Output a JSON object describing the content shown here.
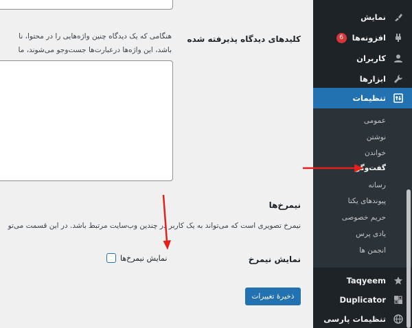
{
  "content": {
    "accepted_keys_label": "کلیدهای دیدگاه پذیرفته شده",
    "accepted_keys_desc_line1": "هنگامی که یک دیدگاه چنین واژه‌هایی را در محتوا، نا",
    "accepted_keys_desc_line2": "باشد، این واژه‌ها درعبارت‌ها جست‌وجو می‌شوند، ما",
    "avatars_title": "نیمرخ‌ها",
    "avatars_desc": "نیمرخ تصویری است که می‌تواند به یک کاربر در چندین وب‌سایت مرتبط باشد. در این قسمت می‌تو",
    "show_avatars_label": "نمایش نیمرخ",
    "show_avatars_checkbox_label": "نمایش نیمرخ‌ها",
    "show_avatars_checked": false,
    "save_button": "ذخیرهٔ تغییرات"
  },
  "sidebar": {
    "items": [
      {
        "label": "نمایش",
        "icon": "brush-icon"
      },
      {
        "label": "افزونه‌ها",
        "icon": "plugin-icon",
        "badge": "6"
      },
      {
        "label": "کاربران",
        "icon": "users-icon"
      },
      {
        "label": "ابزارها",
        "icon": "wrench-icon"
      },
      {
        "label": "تنظیمات",
        "icon": "settings-icon"
      }
    ],
    "submenu": [
      {
        "label": "عمومی"
      },
      {
        "label": "نوشتن"
      },
      {
        "label": "خواندن"
      },
      {
        "label": "گفت‌وگو"
      },
      {
        "label": "رسانه"
      },
      {
        "label": "پیوندهای یکتا"
      },
      {
        "label": "حریم خصوصی"
      },
      {
        "label": "یادی پرس"
      },
      {
        "label": "انجمن ها"
      }
    ],
    "bottom_items": [
      {
        "label": "Taqyeem",
        "icon": "star-icon"
      },
      {
        "label": "Duplicator",
        "icon": "duplicator-icon"
      },
      {
        "label": "تنظیمات پارسی",
        "icon": "globe-icon"
      }
    ]
  },
  "colors": {
    "sidebar_bg": "#1d2327",
    "submenu_bg": "#2c3338",
    "accent": "#2271b1",
    "badge": "#d63638",
    "arrow": "#e2211c"
  }
}
